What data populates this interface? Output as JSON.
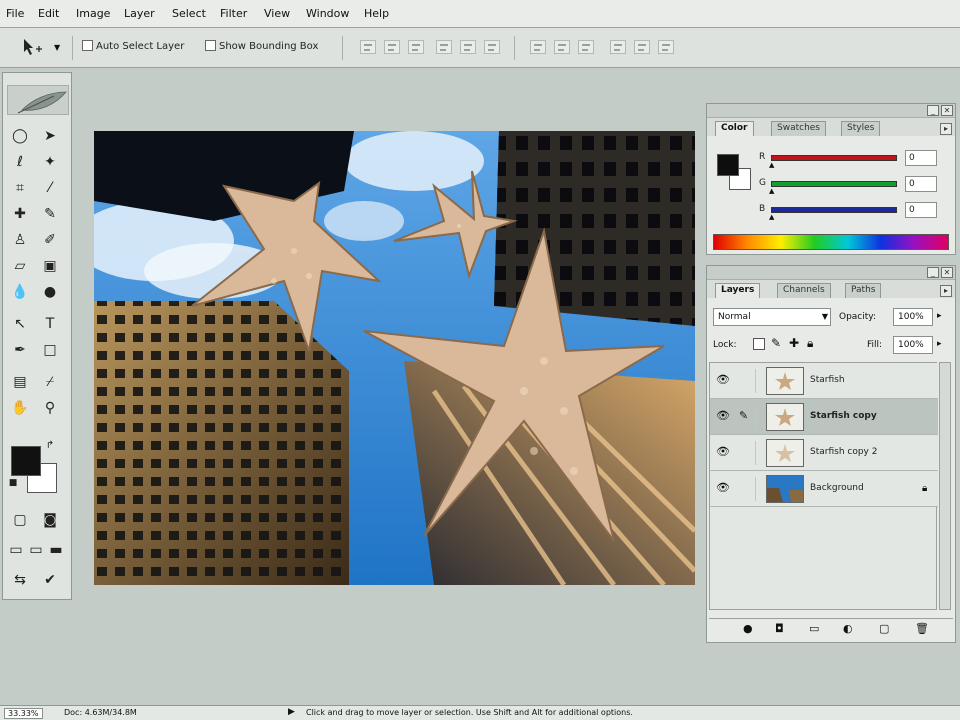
{
  "menus": [
    "File",
    "Edit",
    "Image",
    "Layer",
    "Select",
    "Filter",
    "View",
    "Window",
    "Help"
  ],
  "options_bar": {
    "auto_select_label": "Auto Select Layer",
    "show_bbox_label": "Show Bounding Box"
  },
  "color_panel": {
    "tabs": [
      "Color",
      "Swatches",
      "Styles"
    ],
    "channels": [
      {
        "label": "R",
        "value": "0",
        "color": "#c0141a"
      },
      {
        "label": "G",
        "value": "0",
        "color": "#10a030"
      },
      {
        "label": "B",
        "value": "0",
        "color": "#1a2a9a"
      }
    ]
  },
  "layers_panel": {
    "tabs": [
      "Layers",
      "Channels",
      "Paths"
    ],
    "blend_mode": "Normal",
    "opacity_label": "Opacity:",
    "opacity_value": "100%",
    "lock_label": "Lock:",
    "fill_label": "Fill:",
    "fill_value": "100%",
    "layers": [
      {
        "name": "Starfish",
        "selected": false
      },
      {
        "name": "Starfish copy",
        "selected": true
      },
      {
        "name": "Starfish copy 2",
        "selected": false
      },
      {
        "name": "Background",
        "selected": false
      }
    ]
  },
  "status": {
    "zoom": "33.33%",
    "doc": "Doc: 4.63M/34.8M",
    "hint": "Click and drag to move layer or selection.  Use Shift and Alt for additional options."
  },
  "colors": {
    "foreground": "#111111",
    "background": "#ffffff",
    "workspace": "#c4ccc7"
  }
}
